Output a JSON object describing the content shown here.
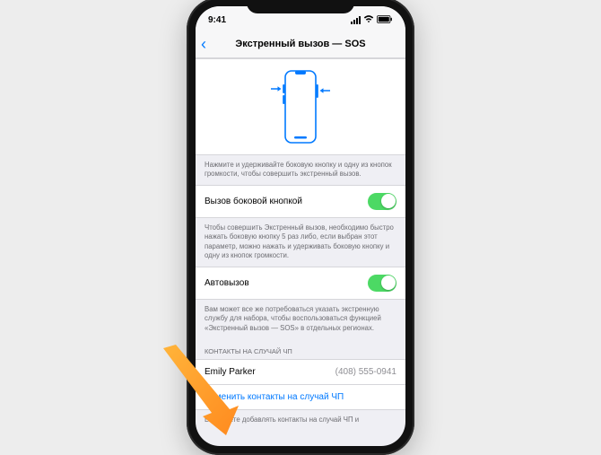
{
  "status": {
    "time": "9:41",
    "signal_icon": "signal",
    "wifi_icon": "wifi",
    "battery_icon": "battery"
  },
  "nav": {
    "back_icon": "‹",
    "title": "Экстренный вызов — SOS"
  },
  "sections": {
    "illus_footer": "Нажмите и удерживайте боковую кнопку и одну из кнопок громкости, чтобы совершить экстренный вызов.",
    "side_button": {
      "label": "Вызов боковой кнопкой",
      "footer": "Чтобы совершить Экстренный вызов, необходимо быстро нажать боковую кнопку 5 раз либо, если выбран этот параметр, можно нажать и удерживать боковую кнопку и одну из кнопок громкости."
    },
    "auto_call": {
      "label": "Автовызов",
      "footer": "Вам может все же потребоваться указать экстренную службу для набора, чтобы воспользоваться функцией «Экстренный вызов — SOS» в отдельных регионах."
    },
    "contacts": {
      "header": "КОНТАКТЫ НА СЛУЧАЙ ЧП",
      "name": "Emily Parker",
      "phone": "(408) 555-0941",
      "edit_link": "Изменить контакты на случай ЧП",
      "footer_partial": "Вы можете добавлять контакты на случай ЧП и"
    }
  }
}
